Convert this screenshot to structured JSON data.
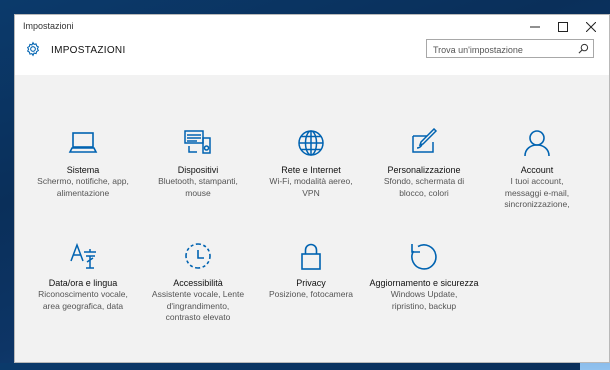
{
  "window": {
    "title": "Impostazioni"
  },
  "header": {
    "app_name": "IMPOSTAZIONI"
  },
  "search": {
    "placeholder": "Trova un'impostazione"
  },
  "colors": {
    "accent": "#0063b1",
    "background": "#f2f2f2"
  },
  "tiles": [
    {
      "name": "Sistema",
      "desc": [
        "Schermo, notifiche, app,",
        "alimentazione"
      ],
      "icon": "laptop-icon"
    },
    {
      "name": "Dispositivi",
      "desc": [
        "Bluetooth, stampanti,",
        "mouse"
      ],
      "icon": "devices-icon"
    },
    {
      "name": "Rete e Internet",
      "desc": [
        "Wi-Fi, modalità aereo,",
        "VPN"
      ],
      "icon": "globe-icon"
    },
    {
      "name": "Personalizzazione",
      "desc": [
        "Sfondo, schermata di",
        "blocco, colori"
      ],
      "icon": "paint-icon"
    },
    {
      "name": "Account",
      "desc": [
        "I tuoi account,",
        "messaggi e-mail,",
        "sincronizzazione,"
      ],
      "icon": "person-icon"
    },
    {
      "name": "Data/ora e lingua",
      "desc": [
        "Riconoscimento vocale,",
        "area geografica, data"
      ],
      "icon": "language-icon"
    },
    {
      "name": "Accessibilità",
      "desc": [
        "Assistente vocale, Lente",
        "d'ingrandimento,",
        "contrasto elevato"
      ],
      "icon": "accessibility-icon"
    },
    {
      "name": "Privacy",
      "desc": [
        "Posizione, fotocamera"
      ],
      "icon": "lock-icon"
    },
    {
      "name": "Aggiornamento e sicurezza",
      "desc": [
        "Windows Update,",
        "ripristino, backup"
      ],
      "icon": "update-icon"
    }
  ]
}
